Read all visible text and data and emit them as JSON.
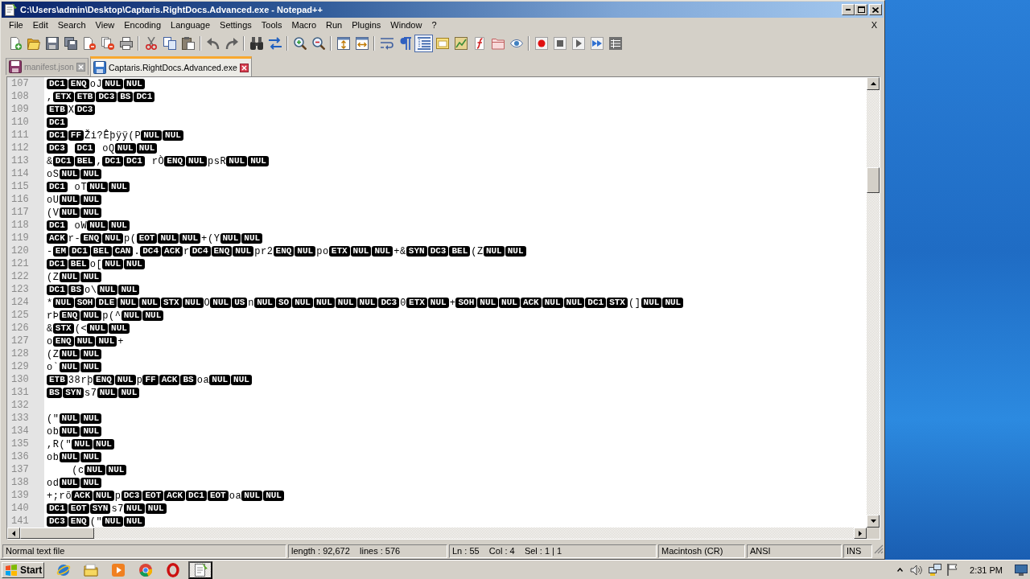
{
  "window": {
    "title": "C:\\Users\\admin\\Desktop\\Captaris.RightDocs.Advanced.exe - Notepad++"
  },
  "menu": {
    "items": [
      "File",
      "Edit",
      "Search",
      "View",
      "Encoding",
      "Language",
      "Settings",
      "Tools",
      "Macro",
      "Run",
      "Plugins",
      "Window",
      "?"
    ],
    "close": "X"
  },
  "toolbar": [
    [
      {
        "kind": "new",
        "pressed": false
      },
      {
        "kind": "open",
        "pressed": false
      },
      {
        "kind": "save",
        "pressed": false
      },
      {
        "kind": "saveall",
        "pressed": false
      },
      {
        "kind": "close",
        "pressed": false
      },
      {
        "kind": "closeall",
        "pressed": false
      },
      {
        "kind": "print",
        "pressed": false
      }
    ],
    [
      {
        "kind": "cut",
        "pressed": false
      },
      {
        "kind": "copy",
        "pressed": false
      },
      {
        "kind": "paste",
        "pressed": false
      }
    ],
    [
      {
        "kind": "undo",
        "pressed": false
      },
      {
        "kind": "redo",
        "pressed": false
      }
    ],
    [
      {
        "kind": "find",
        "pressed": false
      },
      {
        "kind": "replace",
        "pressed": false
      }
    ],
    [
      {
        "kind": "zoomin",
        "pressed": false
      },
      {
        "kind": "zoomout",
        "pressed": false
      }
    ],
    [
      {
        "kind": "syncv",
        "pressed": false
      },
      {
        "kind": "synch",
        "pressed": false
      }
    ],
    [
      {
        "kind": "wrap",
        "pressed": false
      },
      {
        "kind": "allchars",
        "pressed": false
      },
      {
        "kind": "indent",
        "pressed": true
      },
      {
        "kind": "udl",
        "pressed": false
      },
      {
        "kind": "docmap",
        "pressed": false
      },
      {
        "kind": "funclist",
        "pressed": false
      },
      {
        "kind": "workspace",
        "pressed": false
      },
      {
        "kind": "monitor",
        "pressed": false
      }
    ],
    [
      {
        "kind": "record",
        "pressed": false
      },
      {
        "kind": "stop",
        "pressed": false
      },
      {
        "kind": "play",
        "pressed": false
      },
      {
        "kind": "playmulti",
        "pressed": false
      },
      {
        "kind": "savemacro",
        "pressed": false
      }
    ]
  ],
  "tabs": [
    {
      "label": "manifest.json",
      "selected": false,
      "modified": true
    },
    {
      "label": "Captaris.RightDocs.Advanced.exe",
      "selected": true,
      "modified": false
    }
  ],
  "editor": {
    "lines": [
      {
        "number": "107",
        "segments": [
          {
            "kind": "ctrl",
            "text": "DC1"
          },
          {
            "kind": "ctrl",
            "text": "ENQ"
          },
          {
            "kind": "text",
            "text": "oJ"
          },
          {
            "kind": "ctrl",
            "text": "NUL"
          },
          {
            "kind": "ctrl",
            "text": "NUL"
          }
        ]
      },
      {
        "number": "108",
        "segments": [
          {
            "kind": "text",
            "text": ","
          },
          {
            "kind": "ctrl",
            "text": "ETX"
          },
          {
            "kind": "ctrl",
            "text": "ETB"
          },
          {
            "kind": "ctrl",
            "text": "DC3"
          },
          {
            "kind": "ctrl",
            "text": "BS"
          },
          {
            "kind": "ctrl",
            "text": "DC1"
          }
        ]
      },
      {
        "number": "109",
        "segments": [
          {
            "kind": "ctrl",
            "text": "ETB"
          },
          {
            "kind": "text",
            "text": "X"
          },
          {
            "kind": "ctrl",
            "text": "DC3"
          }
        ]
      },
      {
        "number": "110",
        "segments": [
          {
            "kind": "ctrl",
            "text": "DC1"
          }
        ]
      },
      {
        "number": "111",
        "segments": [
          {
            "kind": "ctrl",
            "text": "DC1"
          },
          {
            "kind": "ctrl",
            "text": "FF"
          },
          {
            "kind": "text",
            "text": "Ži?Êþÿÿ(P"
          },
          {
            "kind": "ctrl",
            "text": "NUL"
          },
          {
            "kind": "ctrl",
            "text": "NUL"
          }
        ]
      },
      {
        "number": "112",
        "segments": [
          {
            "kind": "ctrl",
            "text": "DC3"
          },
          {
            "kind": "space"
          },
          {
            "kind": "ctrl",
            "text": "DC1"
          },
          {
            "kind": "space"
          },
          {
            "kind": "text",
            "text": "oQ"
          },
          {
            "kind": "ctrl",
            "text": "NUL"
          },
          {
            "kind": "ctrl",
            "text": "NUL"
          }
        ]
      },
      {
        "number": "113",
        "segments": [
          {
            "kind": "text",
            "text": "&"
          },
          {
            "kind": "ctrl",
            "text": "DC1"
          },
          {
            "kind": "ctrl",
            "text": "BEL"
          },
          {
            "kind": "text",
            "text": ","
          },
          {
            "kind": "ctrl",
            "text": "DC1"
          },
          {
            "kind": "ctrl",
            "text": "DC1"
          },
          {
            "kind": "space"
          },
          {
            "kind": "text",
            "text": "rÒ"
          },
          {
            "kind": "ctrl",
            "text": "ENQ"
          },
          {
            "kind": "ctrl",
            "text": "NUL"
          },
          {
            "kind": "text",
            "text": "psR"
          },
          {
            "kind": "ctrl",
            "text": "NUL"
          },
          {
            "kind": "ctrl",
            "text": "NUL"
          }
        ]
      },
      {
        "number": "114",
        "segments": [
          {
            "kind": "text",
            "text": "oS"
          },
          {
            "kind": "ctrl",
            "text": "NUL"
          },
          {
            "kind": "ctrl",
            "text": "NUL"
          }
        ]
      },
      {
        "number": "115",
        "segments": [
          {
            "kind": "ctrl",
            "text": "DC1"
          },
          {
            "kind": "space"
          },
          {
            "kind": "text",
            "text": "oT"
          },
          {
            "kind": "ctrl",
            "text": "NUL"
          },
          {
            "kind": "ctrl",
            "text": "NUL"
          }
        ]
      },
      {
        "number": "116",
        "segments": [
          {
            "kind": "text",
            "text": "oU"
          },
          {
            "kind": "ctrl",
            "text": "NUL"
          },
          {
            "kind": "ctrl",
            "text": "NUL"
          }
        ]
      },
      {
        "number": "117",
        "segments": [
          {
            "kind": "text",
            "text": "(V"
          },
          {
            "kind": "ctrl",
            "text": "NUL"
          },
          {
            "kind": "ctrl",
            "text": "NUL"
          }
        ]
      },
      {
        "number": "118",
        "segments": [
          {
            "kind": "ctrl",
            "text": "DC1"
          },
          {
            "kind": "space"
          },
          {
            "kind": "text",
            "text": "oW"
          },
          {
            "kind": "ctrl",
            "text": "NUL"
          },
          {
            "kind": "ctrl",
            "text": "NUL"
          }
        ]
      },
      {
        "number": "119",
        "segments": [
          {
            "kind": "ctrl",
            "text": "ACK"
          },
          {
            "kind": "text",
            "text": "r-"
          },
          {
            "kind": "ctrl",
            "text": "ENQ"
          },
          {
            "kind": "ctrl",
            "text": "NUL"
          },
          {
            "kind": "text",
            "text": "p("
          },
          {
            "kind": "ctrl",
            "text": "EOT"
          },
          {
            "kind": "ctrl",
            "text": "NUL"
          },
          {
            "kind": "ctrl",
            "text": "NUL"
          },
          {
            "kind": "text",
            "text": "+(Y"
          },
          {
            "kind": "ctrl",
            "text": "NUL"
          },
          {
            "kind": "ctrl",
            "text": "NUL"
          }
        ]
      },
      {
        "number": "120",
        "segments": [
          {
            "kind": "text",
            "text": "-"
          },
          {
            "kind": "ctrl",
            "text": "EM"
          },
          {
            "kind": "ctrl",
            "text": "DC1"
          },
          {
            "kind": "ctrl",
            "text": "BEL"
          },
          {
            "kind": "ctrl",
            "text": "CAN"
          },
          {
            "kind": "text",
            "text": "."
          },
          {
            "kind": "ctrl",
            "text": "DC4"
          },
          {
            "kind": "ctrl",
            "text": "ACK"
          },
          {
            "kind": "text",
            "text": "r"
          },
          {
            "kind": "ctrl",
            "text": "DC4"
          },
          {
            "kind": "ctrl",
            "text": "ENQ"
          },
          {
            "kind": "ctrl",
            "text": "NUL"
          },
          {
            "kind": "text",
            "text": "pr2"
          },
          {
            "kind": "ctrl",
            "text": "ENQ"
          },
          {
            "kind": "ctrl",
            "text": "NUL"
          },
          {
            "kind": "text",
            "text": "po"
          },
          {
            "kind": "ctrl",
            "text": "ETX"
          },
          {
            "kind": "ctrl",
            "text": "NUL"
          },
          {
            "kind": "ctrl",
            "text": "NUL"
          },
          {
            "kind": "text",
            "text": "+&"
          },
          {
            "kind": "ctrl",
            "text": "SYN"
          },
          {
            "kind": "ctrl",
            "text": "DC3"
          },
          {
            "kind": "ctrl",
            "text": "BEL"
          },
          {
            "kind": "text",
            "text": "(Z"
          },
          {
            "kind": "ctrl",
            "text": "NUL"
          },
          {
            "kind": "ctrl",
            "text": "NUL"
          }
        ]
      },
      {
        "number": "121",
        "segments": [
          {
            "kind": "ctrl",
            "text": "DC1"
          },
          {
            "kind": "ctrl",
            "text": "BEL"
          },
          {
            "kind": "text",
            "text": "o["
          },
          {
            "kind": "ctrl",
            "text": "NUL"
          },
          {
            "kind": "ctrl",
            "text": "NUL"
          }
        ]
      },
      {
        "number": "122",
        "segments": [
          {
            "kind": "text",
            "text": "(Z"
          },
          {
            "kind": "ctrl",
            "text": "NUL"
          },
          {
            "kind": "ctrl",
            "text": "NUL"
          }
        ]
      },
      {
        "number": "123",
        "segments": [
          {
            "kind": "ctrl",
            "text": "DC1"
          },
          {
            "kind": "ctrl",
            "text": "BS"
          },
          {
            "kind": "text",
            "text": "o\\"
          },
          {
            "kind": "ctrl",
            "text": "NUL"
          },
          {
            "kind": "ctrl",
            "text": "NUL"
          }
        ]
      },
      {
        "number": "124",
        "segments": [
          {
            "kind": "text",
            "text": "*"
          },
          {
            "kind": "ctrl",
            "text": "NUL"
          },
          {
            "kind": "ctrl",
            "text": "SOH"
          },
          {
            "kind": "ctrl",
            "text": "DLE"
          },
          {
            "kind": "ctrl",
            "text": "NUL"
          },
          {
            "kind": "ctrl",
            "text": "NUL"
          },
          {
            "kind": "ctrl",
            "text": "STX"
          },
          {
            "kind": "ctrl",
            "text": "NUL"
          },
          {
            "kind": "text",
            "text": "O"
          },
          {
            "kind": "ctrl",
            "text": "NUL"
          },
          {
            "kind": "ctrl",
            "text": "US"
          },
          {
            "kind": "text",
            "text": "n"
          },
          {
            "kind": "ctrl",
            "text": "NUL"
          },
          {
            "kind": "ctrl",
            "text": "SO"
          },
          {
            "kind": "ctrl",
            "text": "NUL"
          },
          {
            "kind": "ctrl",
            "text": "NUL"
          },
          {
            "kind": "ctrl",
            "text": "NUL"
          },
          {
            "kind": "ctrl",
            "text": "NUL"
          },
          {
            "kind": "ctrl",
            "text": "DC3"
          },
          {
            "kind": "text",
            "text": "0"
          },
          {
            "kind": "ctrl",
            "text": "ETX"
          },
          {
            "kind": "ctrl",
            "text": "NUL"
          },
          {
            "kind": "text",
            "text": "+"
          },
          {
            "kind": "ctrl",
            "text": "SOH"
          },
          {
            "kind": "ctrl",
            "text": "NUL"
          },
          {
            "kind": "ctrl",
            "text": "NUL"
          },
          {
            "kind": "ctrl",
            "text": "ACK"
          },
          {
            "kind": "ctrl",
            "text": "NUL"
          },
          {
            "kind": "ctrl",
            "text": "NUL"
          },
          {
            "kind": "ctrl",
            "text": "DC1"
          },
          {
            "kind": "ctrl",
            "text": "STX"
          },
          {
            "kind": "text",
            "text": "(]"
          },
          {
            "kind": "ctrl",
            "text": "NUL"
          },
          {
            "kind": "ctrl",
            "text": "NUL"
          }
        ]
      },
      {
        "number": "125",
        "segments": [
          {
            "kind": "text",
            "text": "rÞ"
          },
          {
            "kind": "ctrl",
            "text": "ENQ"
          },
          {
            "kind": "ctrl",
            "text": "NUL"
          },
          {
            "kind": "text",
            "text": "p(^"
          },
          {
            "kind": "ctrl",
            "text": "NUL"
          },
          {
            "kind": "ctrl",
            "text": "NUL"
          }
        ]
      },
      {
        "number": "126",
        "segments": [
          {
            "kind": "text",
            "text": "&"
          },
          {
            "kind": "ctrl",
            "text": "STX"
          },
          {
            "kind": "text",
            "text": "(<"
          },
          {
            "kind": "ctrl",
            "text": "NUL"
          },
          {
            "kind": "ctrl",
            "text": "NUL"
          }
        ]
      },
      {
        "number": "127",
        "segments": [
          {
            "kind": "text",
            "text": "o"
          },
          {
            "kind": "ctrl",
            "text": "ENQ"
          },
          {
            "kind": "ctrl",
            "text": "NUL"
          },
          {
            "kind": "ctrl",
            "text": "NUL"
          },
          {
            "kind": "text",
            "text": "+"
          }
        ]
      },
      {
        "number": "128",
        "segments": [
          {
            "kind": "text",
            "text": "(Z"
          },
          {
            "kind": "ctrl",
            "text": "NUL"
          },
          {
            "kind": "ctrl",
            "text": "NUL"
          }
        ]
      },
      {
        "number": "129",
        "segments": [
          {
            "kind": "text",
            "text": "o`"
          },
          {
            "kind": "ctrl",
            "text": "NUL"
          },
          {
            "kind": "ctrl",
            "text": "NUL"
          }
        ]
      },
      {
        "number": "130",
        "segments": [
          {
            "kind": "ctrl",
            "text": "ETB"
          },
          {
            "kind": "text",
            "text": "38rþ"
          },
          {
            "kind": "ctrl",
            "text": "ENQ"
          },
          {
            "kind": "ctrl",
            "text": "NUL"
          },
          {
            "kind": "text",
            "text": "p"
          },
          {
            "kind": "ctrl",
            "text": "FF"
          },
          {
            "kind": "ctrl",
            "text": "ACK"
          },
          {
            "kind": "ctrl",
            "text": "BS"
          },
          {
            "kind": "text",
            "text": "oa"
          },
          {
            "kind": "ctrl",
            "text": "NUL"
          },
          {
            "kind": "ctrl",
            "text": "NUL"
          }
        ]
      },
      {
        "number": "131",
        "segments": [
          {
            "kind": "ctrl",
            "text": "BS"
          },
          {
            "kind": "ctrl",
            "text": "SYN"
          },
          {
            "kind": "text",
            "text": "s7"
          },
          {
            "kind": "ctrl",
            "text": "NUL"
          },
          {
            "kind": "ctrl",
            "text": "NUL"
          }
        ]
      },
      {
        "number": "132"
      },
      {
        "number": "133",
        "segments": [
          {
            "kind": "text",
            "text": "(\""
          },
          {
            "kind": "ctrl",
            "text": "NUL"
          },
          {
            "kind": "ctrl",
            "text": "NUL"
          }
        ]
      },
      {
        "number": "134",
        "segments": [
          {
            "kind": "text",
            "text": "ob"
          },
          {
            "kind": "ctrl",
            "text": "NUL"
          },
          {
            "kind": "ctrl",
            "text": "NUL"
          }
        ]
      },
      {
        "number": "135",
        "segments": [
          {
            "kind": "text",
            "text": ",R(\""
          },
          {
            "kind": "ctrl",
            "text": "NUL"
          },
          {
            "kind": "ctrl",
            "text": "NUL"
          }
        ]
      },
      {
        "number": "136",
        "segments": [
          {
            "kind": "text",
            "text": "ob"
          },
          {
            "kind": "ctrl",
            "text": "NUL"
          },
          {
            "kind": "ctrl",
            "text": "NUL"
          }
        ]
      },
      {
        "number": "137",
        "segments": [
          {
            "kind": "space"
          },
          {
            "kind": "space"
          },
          {
            "kind": "space"
          },
          {
            "kind": "space"
          },
          {
            "kind": "text",
            "text": "(c"
          },
          {
            "kind": "ctrl",
            "text": "NUL"
          },
          {
            "kind": "ctrl",
            "text": "NUL"
          }
        ]
      },
      {
        "number": "138",
        "segments": [
          {
            "kind": "text",
            "text": "od"
          },
          {
            "kind": "ctrl",
            "text": "NUL"
          },
          {
            "kind": "ctrl",
            "text": "NUL"
          }
        ]
      },
      {
        "number": "139",
        "segments": [
          {
            "kind": "text",
            "text": "+;rõ"
          },
          {
            "kind": "ctrl",
            "text": "ACK"
          },
          {
            "kind": "ctrl",
            "text": "NUL"
          },
          {
            "kind": "text",
            "text": "p"
          },
          {
            "kind": "ctrl",
            "text": "DC3"
          },
          {
            "kind": "ctrl",
            "text": "EOT"
          },
          {
            "kind": "ctrl",
            "text": "ACK"
          },
          {
            "kind": "ctrl",
            "text": "DC1"
          },
          {
            "kind": "ctrl",
            "text": "EOT"
          },
          {
            "kind": "text",
            "text": "oa"
          },
          {
            "kind": "ctrl",
            "text": "NUL"
          },
          {
            "kind": "ctrl",
            "text": "NUL"
          }
        ]
      },
      {
        "number": "140",
        "segments": [
          {
            "kind": "ctrl",
            "text": "DC1"
          },
          {
            "kind": "ctrl",
            "text": "EOT"
          },
          {
            "kind": "ctrl",
            "text": "SYN"
          },
          {
            "kind": "text",
            "text": "s7"
          },
          {
            "kind": "ctrl",
            "text": "NUL"
          },
          {
            "kind": "ctrl",
            "text": "NUL"
          }
        ]
      },
      {
        "number": "141",
        "segments": [
          {
            "kind": "ctrl",
            "text": "DC3"
          },
          {
            "kind": "ctrl",
            "text": "ENQ"
          },
          {
            "kind": "text",
            "text": "(\""
          },
          {
            "kind": "ctrl",
            "text": "NUL"
          },
          {
            "kind": "ctrl",
            "text": "NUL"
          }
        ]
      }
    ]
  },
  "status_bar": [
    "Normal text file",
    "length : 92,672    lines : 576",
    "Ln : 55    Col : 4    Sel : 1 | 1",
    "Macintosh (CR)",
    "ANSI",
    "INS"
  ],
  "taskbar": {
    "start": "Start",
    "apps": [
      {
        "kind": "globe",
        "pressed": false
      },
      {
        "kind": "folder",
        "pressed": false
      },
      {
        "kind": "player",
        "pressed": false
      },
      {
        "kind": "wheel",
        "pressed": false
      },
      {
        "kind": "ring",
        "pressed": false
      },
      {
        "kind": "notepad",
        "pressed": true
      }
    ],
    "clock": "2:31 PM"
  }
}
